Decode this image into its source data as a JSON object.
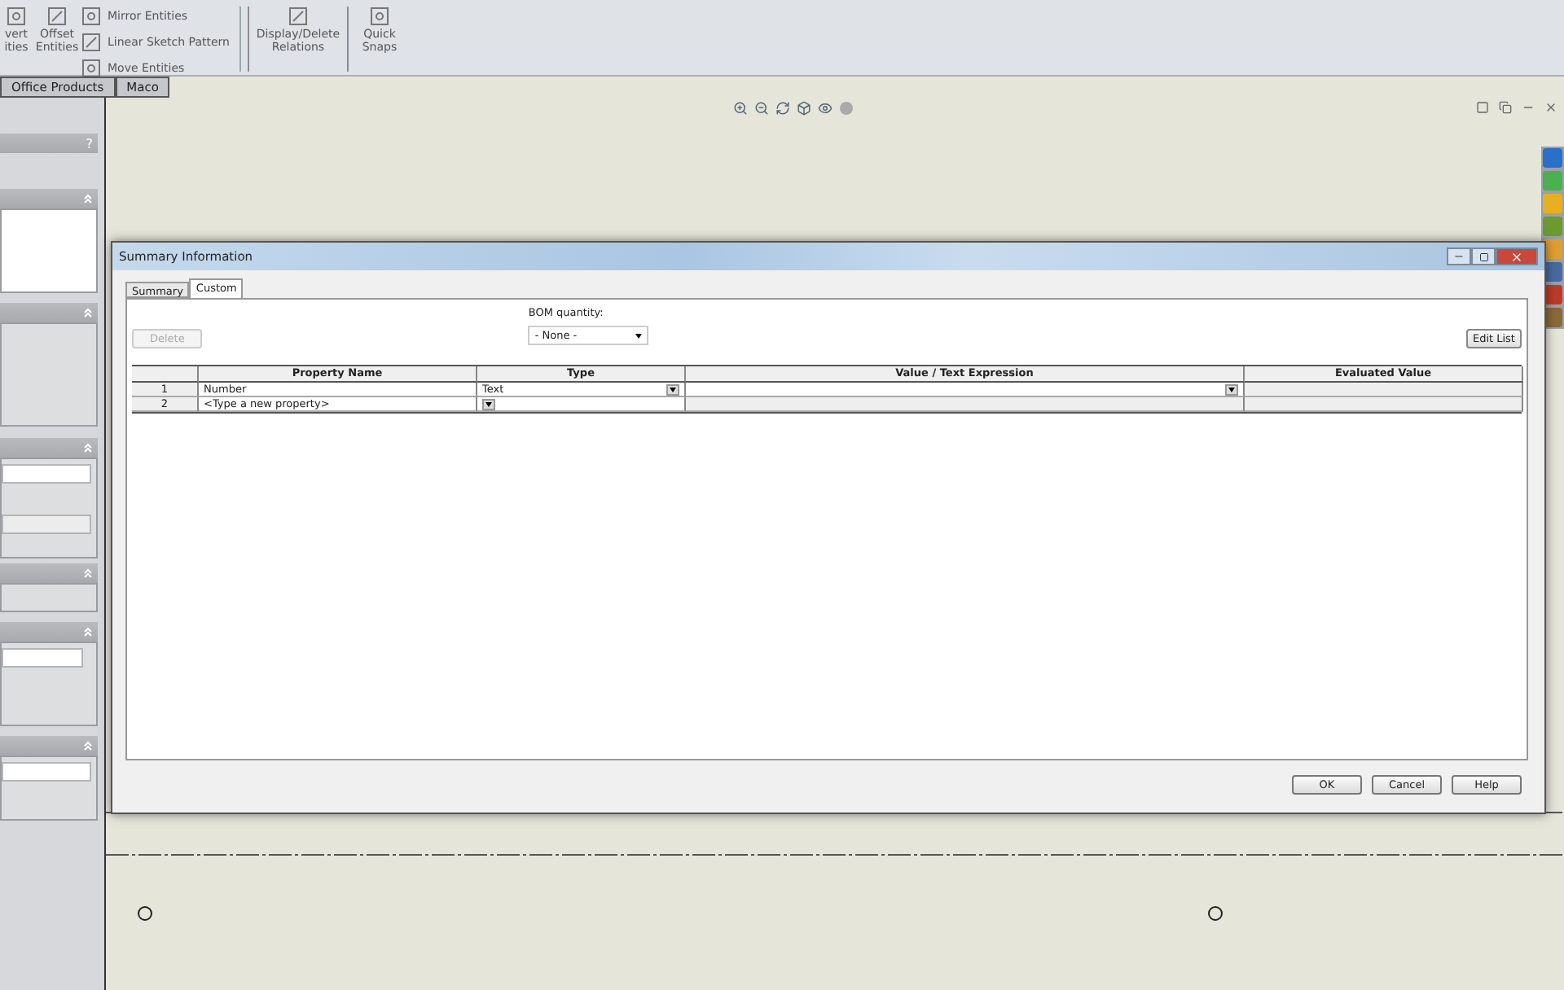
{
  "ribbon": {
    "tools": [
      {
        "label": "vert ities",
        "kind": "large"
      },
      {
        "label": "Offset Entities",
        "kind": "large"
      },
      {
        "kind": "stack",
        "items": [
          "Mirror Entities",
          "Linear Sketch Pattern",
          "Move Entities"
        ]
      },
      {
        "label": "Display/Delete Relations",
        "kind": "large"
      },
      {
        "label": "Quick Snaps",
        "kind": "large"
      }
    ]
  },
  "doc_tabs": [
    {
      "label": "Office Products"
    },
    {
      "label": "Maco"
    }
  ],
  "left_panel": {
    "help": "?"
  },
  "dialog": {
    "title": "Summary Information",
    "tabs": [
      {
        "label": "Summary",
        "selected": false
      },
      {
        "label": "Custom",
        "selected": true
      }
    ],
    "delete_button": {
      "label": "Delete",
      "disabled": true
    },
    "bom_label": "BOM quantity:",
    "bom_value": "- None -",
    "edit_list": "Edit List",
    "columns": [
      "Property Name",
      "Type",
      "Value / Text Expression",
      "Evaluated Value"
    ],
    "rows": [
      {
        "number": "1",
        "name": "Number",
        "type": "Text",
        "kind": "property"
      },
      {
        "number": "2",
        "name": "<Type a new property>",
        "kind": "new"
      }
    ],
    "buttons": [
      "OK",
      "Cancel",
      "Help"
    ]
  }
}
